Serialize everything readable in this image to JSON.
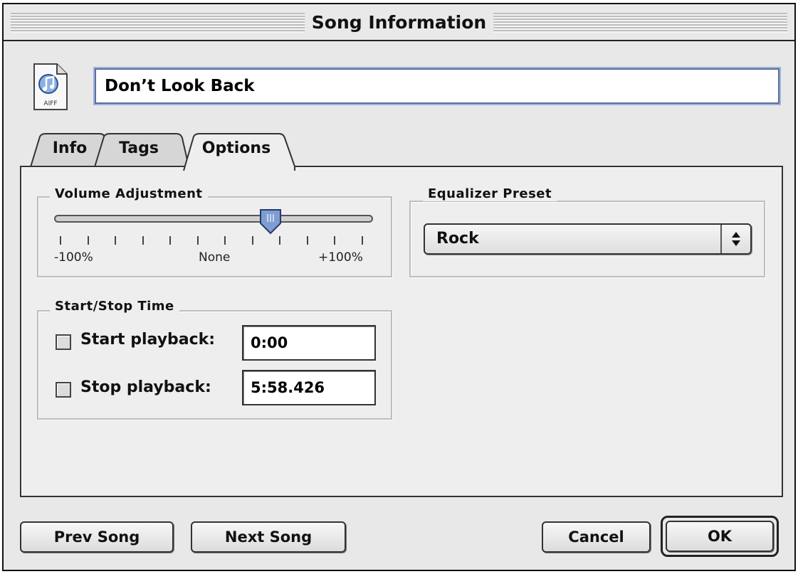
{
  "window": {
    "title": "Song Information"
  },
  "song": {
    "name": "Don’t Look Back",
    "file_type_label": "AIFF"
  },
  "tabs": [
    {
      "label": "Info",
      "selected": false
    },
    {
      "label": "Tags",
      "selected": false
    },
    {
      "label": "Options",
      "selected": true
    }
  ],
  "volume": {
    "label": "Volume Adjustment",
    "min_label": "-100%",
    "mid_label": "None",
    "max_label": "+100%",
    "value_fraction": 0.68
  },
  "equalizer": {
    "label": "Equalizer Preset",
    "value": "Rock"
  },
  "start_stop": {
    "label": "Start/Stop Time",
    "start_label": "Start playback:",
    "start_value": "0:00",
    "start_checked": false,
    "stop_label": "Stop playback:",
    "stop_value": "5:58.426",
    "stop_checked": false
  },
  "buttons": {
    "prev": "Prev Song",
    "next": "Next Song",
    "cancel": "Cancel",
    "ok": "OK"
  },
  "colors": {
    "window_bg": "#e8e8e8",
    "focus_ring": "#9fb2d8",
    "slider_thumb": "#6f8fc8"
  }
}
